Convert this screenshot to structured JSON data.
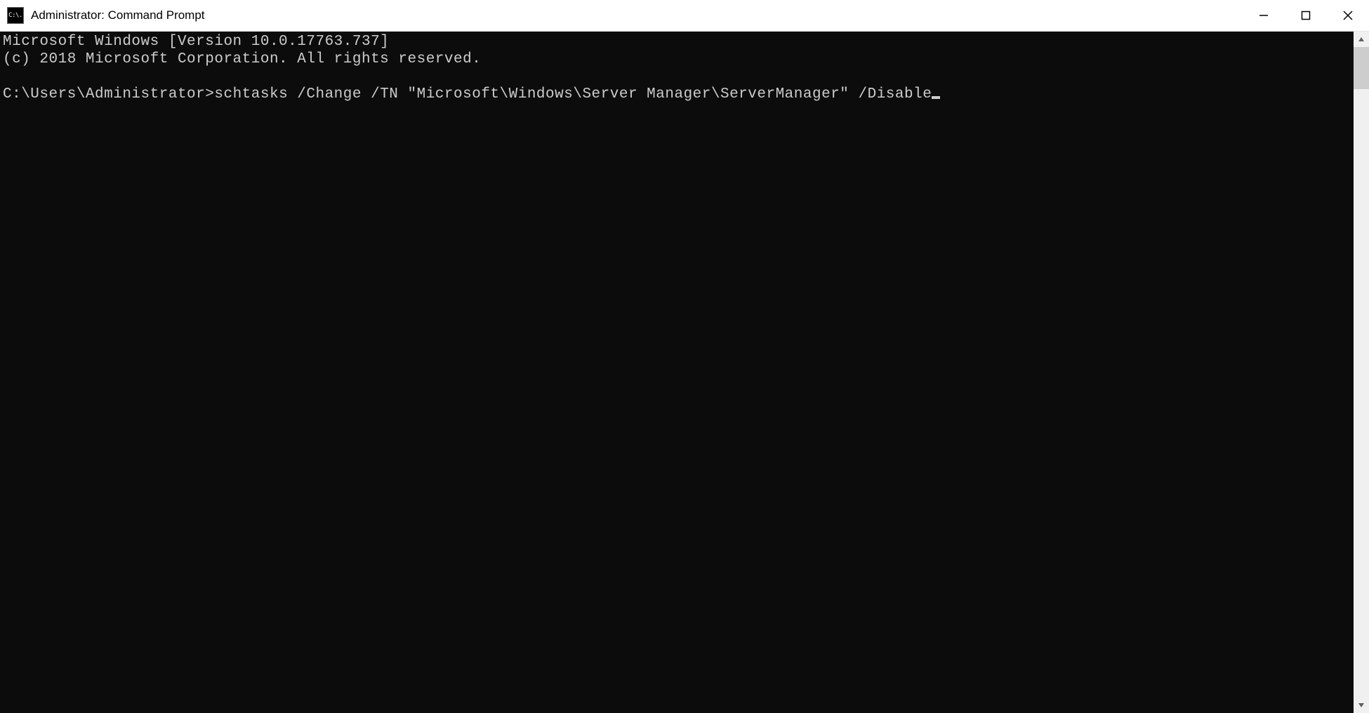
{
  "window": {
    "title": "Administrator: Command Prompt",
    "icon_label": "C:\\."
  },
  "console": {
    "line1": "Microsoft Windows [Version 10.0.17763.737]",
    "line2": "(c) 2018 Microsoft Corporation. All rights reserved.",
    "blank": "",
    "prompt": "C:\\Users\\Administrator>",
    "command": "schtasks /Change /TN \"Microsoft\\Windows\\Server Manager\\ServerManager\" /Disable"
  }
}
